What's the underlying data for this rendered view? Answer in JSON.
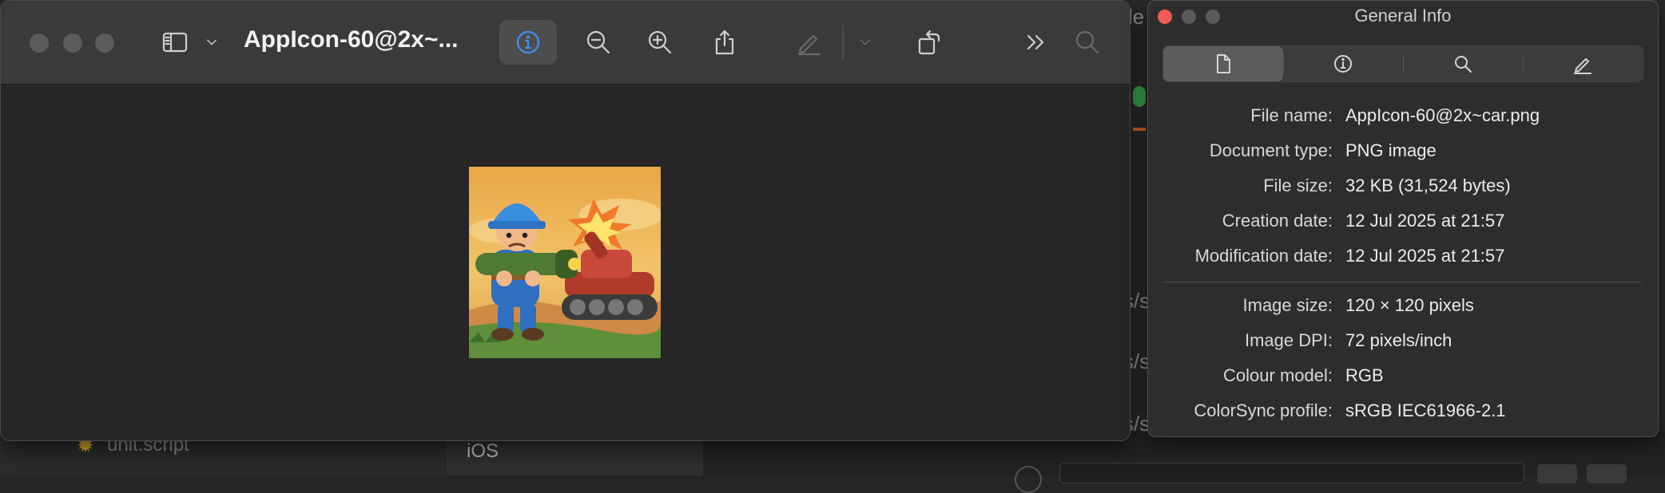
{
  "background": {
    "sidebar_file": "unit.script",
    "platform_label": "iOS",
    "ghost_fragments": [
      "le",
      "s/s",
      "s/s",
      "s/s"
    ]
  },
  "preview": {
    "title": "AppIcon-60@2x~...",
    "traffic_lights": [
      "close",
      "minimize",
      "zoom"
    ],
    "toolbar": [
      {
        "name": "sidebar-toggle",
        "icon": "sidebar-icon"
      },
      {
        "name": "sidebar-menu",
        "icon": "chevron-down-icon"
      },
      {
        "name": "get-info",
        "icon": "info-icon",
        "active": true
      },
      {
        "name": "zoom-out",
        "icon": "zoom-out-icon"
      },
      {
        "name": "zoom-in",
        "icon": "zoom-in-icon"
      },
      {
        "name": "share",
        "icon": "share-icon"
      },
      {
        "name": "markup",
        "icon": "pen-icon",
        "disabled": true
      },
      {
        "name": "markup-menu",
        "icon": "chevron-down-icon",
        "disabled": true
      },
      {
        "name": "rotate",
        "icon": "rotate-icon"
      },
      {
        "name": "more",
        "icon": "double-chevron-right-icon"
      },
      {
        "name": "search",
        "icon": "search-icon",
        "disabled": true
      }
    ],
    "image": {
      "subject": "cartoon soldier with bazooka and red tank",
      "icon": "app-icon-image"
    }
  },
  "info_panel": {
    "title": "General Info",
    "tabs": [
      {
        "name": "general",
        "icon": "document-icon",
        "selected": true
      },
      {
        "name": "more-info",
        "icon": "info-icon"
      },
      {
        "name": "keywords",
        "icon": "search-icon"
      },
      {
        "name": "annotations",
        "icon": "pen-icon"
      }
    ],
    "rows": [
      {
        "label": "File name:",
        "value": "AppIcon-60@2x~car.png"
      },
      {
        "label": "Document type:",
        "value": "PNG image"
      },
      {
        "label": "File size:",
        "value": "32 KB (31,524 bytes)"
      },
      {
        "label": "Creation date:",
        "value": "12 Jul 2025 at 21:57"
      },
      {
        "label": "Modification date:",
        "value": "12 Jul 2025 at 21:57"
      },
      {
        "label": "Image size:",
        "value": "120 × 120 pixels"
      },
      {
        "label": "Image DPI:",
        "value": "72 pixels/inch"
      },
      {
        "label": "Colour model:",
        "value": "RGB"
      },
      {
        "label": "ColorSync profile:",
        "value": "sRGB IEC61966-2.1"
      }
    ]
  },
  "colors": {
    "toolbar": "#3a3a3a",
    "window": "#262626",
    "panel": "#2d2d2d",
    "accent_blue": "#3d8ff5",
    "close_red": "#ed5c56"
  }
}
